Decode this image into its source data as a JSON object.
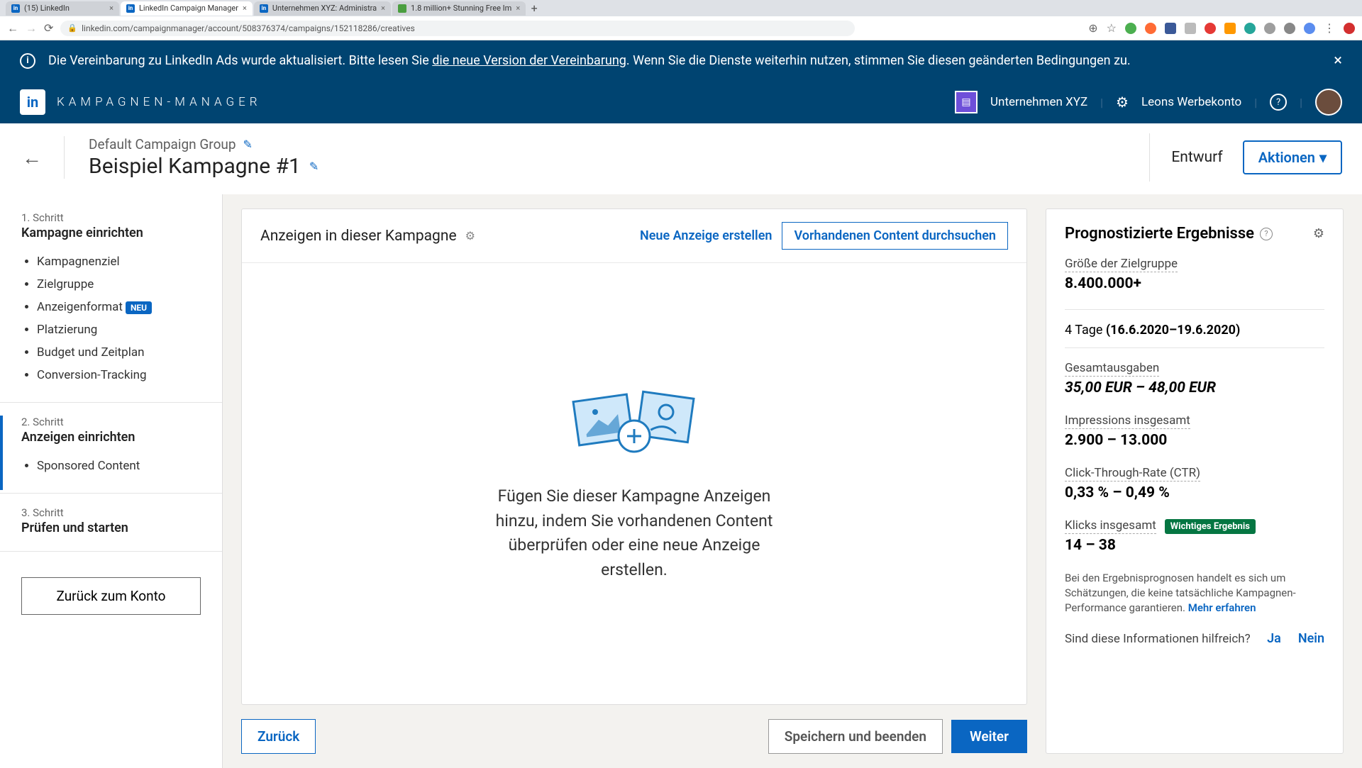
{
  "browser": {
    "tabs": [
      {
        "label": "(15) LinkedIn"
      },
      {
        "label": "LinkedIn Campaign Manager"
      },
      {
        "label": "Unternehmen XYZ: Administra"
      },
      {
        "label": "1.8 million+ Stunning Free Im"
      }
    ],
    "url": "linkedin.com/campaignmanager/account/508376374/campaigns/152118286/creatives"
  },
  "banner": {
    "text_pre": "Die Vereinbarung zu LinkedIn Ads wurde aktualisiert. Bitte lesen Sie ",
    "link": "die neue Version der Vereinbarung",
    "text_post": ". Wenn Sie die Dienste weiterhin nutzen, stimmen Sie diesen geänderten Bedingungen zu."
  },
  "topnav": {
    "title": "KAMPAGNEN-MANAGER",
    "company": "Unternehmen XYZ",
    "account": "Leons Werbekonto"
  },
  "pagehead": {
    "group": "Default Campaign Group",
    "name": "Beispiel Kampagne #1",
    "status": "Entwurf",
    "actions_label": "Aktionen"
  },
  "sidebar": {
    "step1_label": "1. Schritt",
    "step1_title": "Kampagne einrichten",
    "step1_items": [
      "Kampagnenziel",
      "Zielgruppe",
      "Anzeigenformat",
      "Platzierung",
      "Budget und Zeitplan",
      "Conversion-Tracking"
    ],
    "new_badge": "NEU",
    "step2_label": "2. Schritt",
    "step2_title": "Anzeigen einrichten",
    "step2_items": [
      "Sponsored Content"
    ],
    "step3_label": "3. Schritt",
    "step3_title": "Prüfen und starten",
    "back_account": "Zurück zum Konto"
  },
  "center": {
    "panel_title": "Anzeigen in dieser Kampagne",
    "create_ad": "Neue Anzeige erstellen",
    "browse_content": "Vorhandenen Content durchsuchen",
    "empty_text": "Fügen Sie dieser Kampagne Anzeigen hinzu, indem Sie vorhandenen Content überprüfen oder eine neue Anzeige erstellen.",
    "back": "Zurück",
    "save_exit": "Speichern und beenden",
    "next": "Weiter"
  },
  "forecast": {
    "title": "Prognostizierte Ergebnisse",
    "audience_label": "Größe der Zielgruppe",
    "audience_value": "8.400.000+",
    "duration_prefix": "4 Tage",
    "duration_range": "(16.6.2020–19.6.2020)",
    "spend_label": "Gesamtausgaben",
    "spend_value": "35,00 EUR – 48,00 EUR",
    "impressions_label": "Impressions insgesamt",
    "impressions_value": "2.900 – 13.000",
    "ctr_label": "Click-Through-Rate (CTR)",
    "ctr_value": "0,33 % – 0,49 %",
    "clicks_label": "Klicks insgesamt",
    "clicks_value": "14 – 38",
    "important_badge": "Wichtiges Ergebnis",
    "disclaimer": "Bei den Ergebnisprognosen handelt es sich um Schätzungen, die keine tatsächliche Kampagnen-Performance garantieren.",
    "learn_more": "Mehr erfahren",
    "helpful_q": "Sind diese Informationen hilfreich?",
    "yes": "Ja",
    "no": "Nein"
  }
}
